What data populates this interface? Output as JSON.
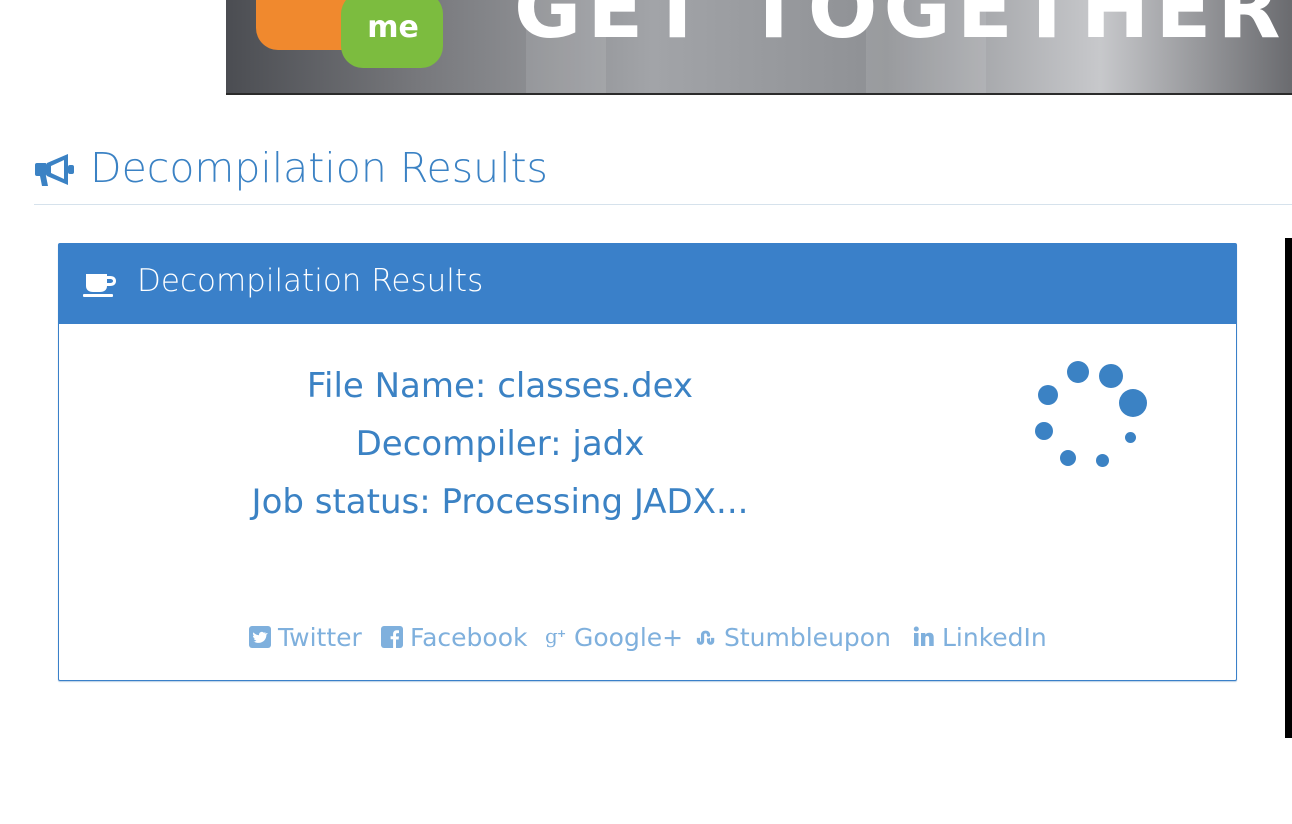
{
  "banner": {
    "badge_text": "me",
    "headline": "GET TOGETHER"
  },
  "page_header": {
    "title": "Decompilation Results"
  },
  "panel": {
    "title": "Decompilation Results",
    "file_name_line": "File Name: classes.dex",
    "decompiler_line": "Decompiler: jadx",
    "job_status_line": "Job status: Processing JADX..."
  },
  "social": {
    "items": [
      {
        "label": "Twitter",
        "icon": "twitter-square-icon"
      },
      {
        "label": "Facebook",
        "icon": "facebook-square-icon"
      },
      {
        "label": "Google+",
        "icon": "google-plus-icon"
      },
      {
        "label": "Stumbleupon",
        "icon": "stumbleupon-icon"
      },
      {
        "label": "LinkedIn",
        "icon": "linkedin-icon"
      }
    ]
  },
  "colors": {
    "accent": "#3a80c9",
    "link": "#3b82c4",
    "social_link": "#7fb0dd"
  }
}
